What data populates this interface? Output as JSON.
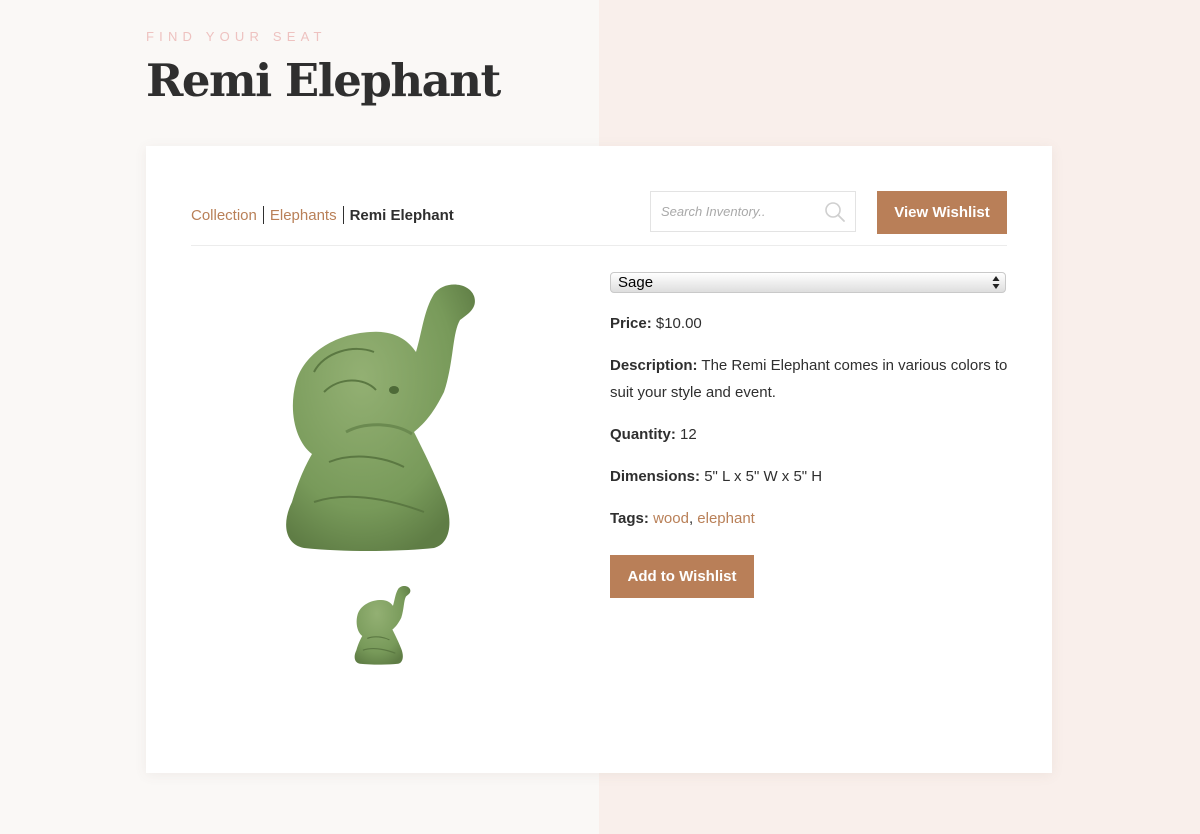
{
  "header": {
    "eyebrow": "FIND YOUR SEAT",
    "title": "Remi Elephant"
  },
  "breadcrumb": {
    "items": [
      "Collection",
      "Elephants"
    ],
    "current": "Remi Elephant"
  },
  "search": {
    "placeholder": "Search Inventory..",
    "icon": "search-icon"
  },
  "buttons": {
    "view_wishlist": "View Wishlist",
    "add_to_wishlist": "Add to Wishlist"
  },
  "product": {
    "color_select": "Sage",
    "price_label": "Price:",
    "price": "$10.00",
    "description_label": "Description:",
    "description": "The Remi Elephant comes in various colors to suit your style and event.",
    "quantity_label": "Quantity:",
    "quantity": "12",
    "dimensions_label": "Dimensions:",
    "dimensions": "5\" L x 5\" W x 5\" H",
    "tags_label": "Tags:",
    "tags": [
      "wood",
      "elephant"
    ],
    "tag_separator": ","
  },
  "colors": {
    "accent": "#b97f58",
    "eyebrow": "#eec2c0",
    "product": "#7b9a5e",
    "bg_left": "#faf8f6",
    "bg_right": "#f9efeb"
  }
}
